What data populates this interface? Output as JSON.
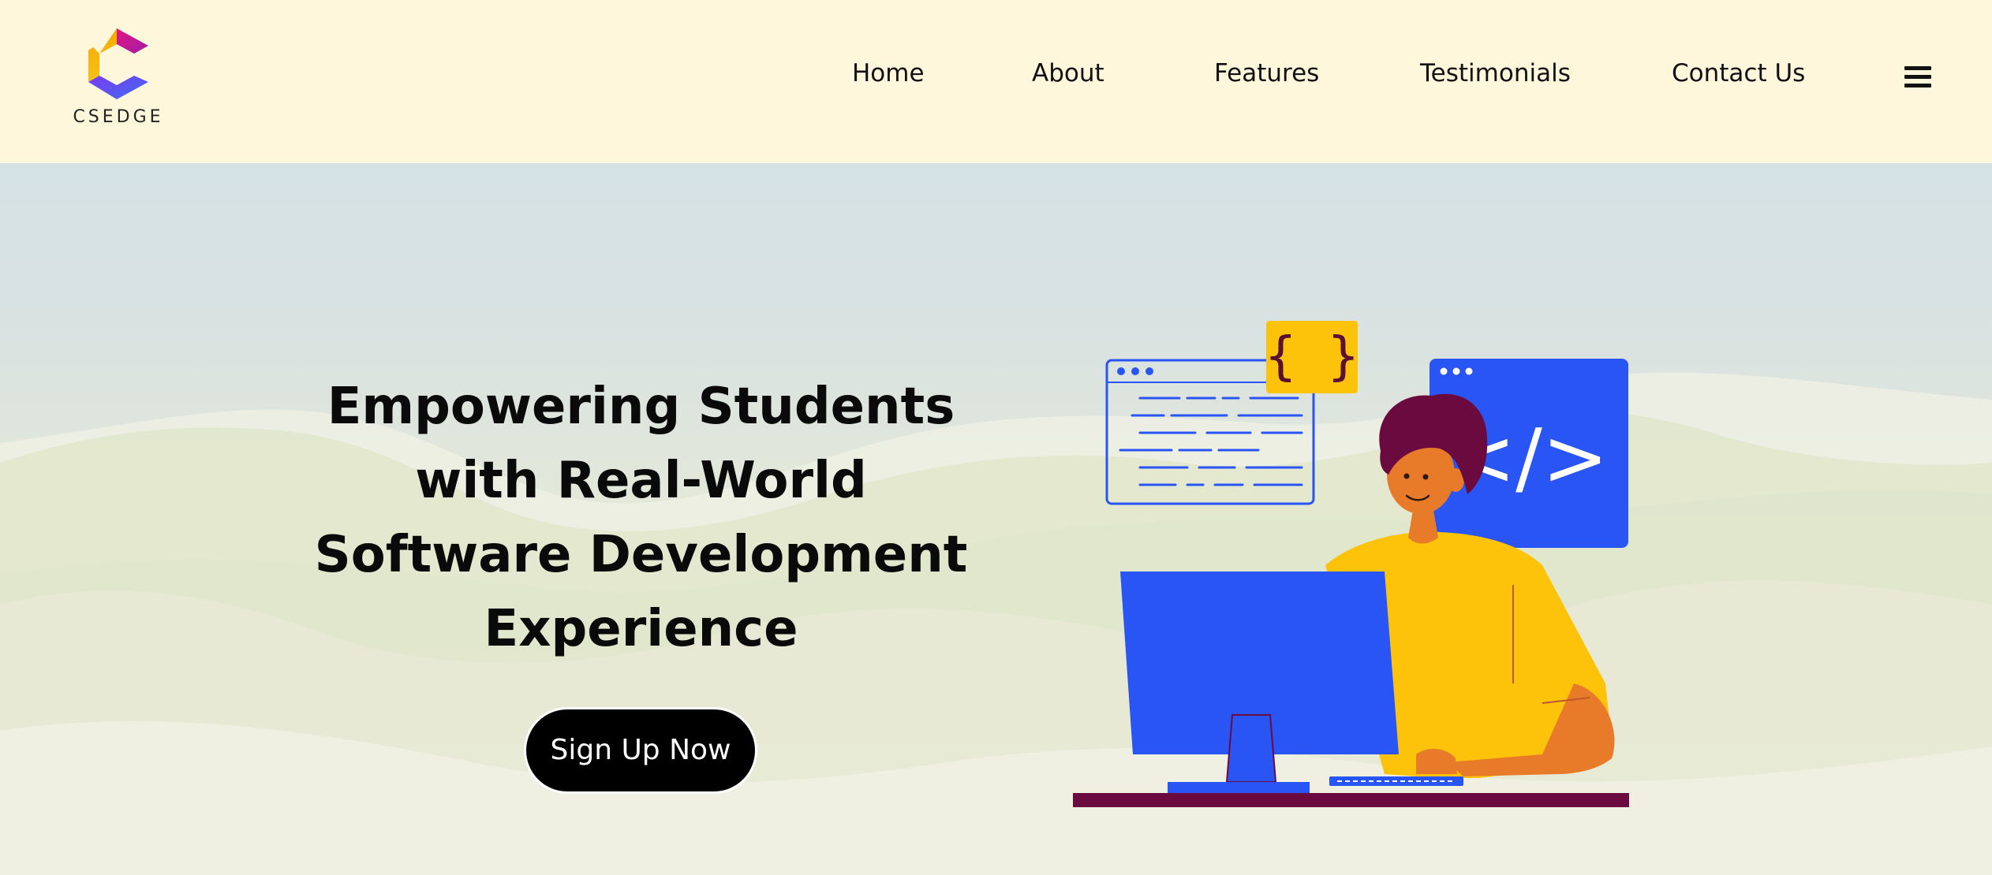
{
  "brand": {
    "name": "CSEDGE"
  },
  "nav": {
    "items": [
      {
        "label": "Home"
      },
      {
        "label": "About"
      },
      {
        "label": "Features"
      },
      {
        "label": "Testimonials"
      },
      {
        "label": "Contact Us"
      }
    ],
    "menu_icon": "hamburger-menu-icon"
  },
  "hero": {
    "headline_lines": [
      "Empowering Students",
      "with Real-World",
      "Software Development",
      "Experience"
    ],
    "cta_label": "Sign Up Now",
    "illustration": {
      "code_braces": "{ }",
      "code_tag": "</>"
    }
  },
  "colors": {
    "header_bg": "#fff7db",
    "cta_bg": "#000000",
    "accent_blue": "#2a55f5",
    "accent_yellow": "#fcc30a",
    "accent_orange": "#e87b2a",
    "desk": "#6b0a3f"
  }
}
